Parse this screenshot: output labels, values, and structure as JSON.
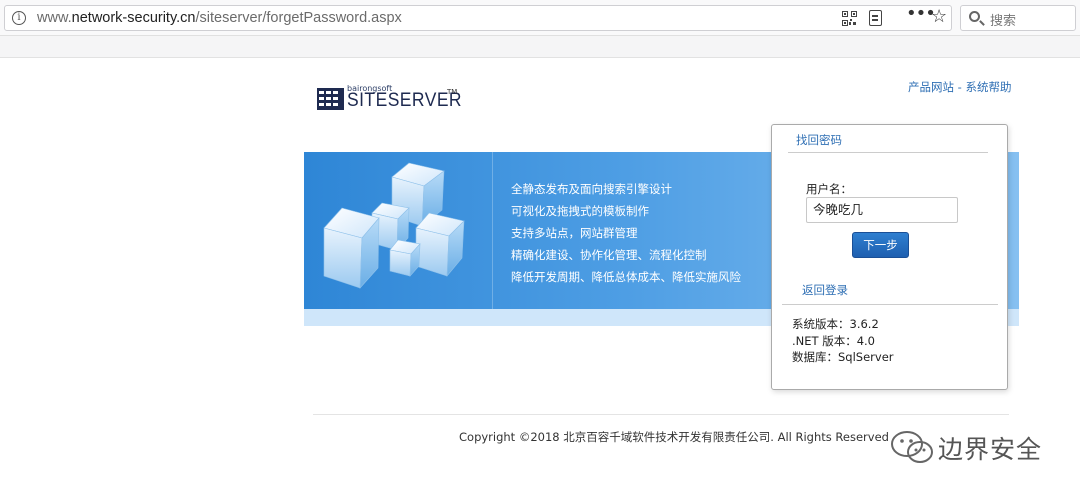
{
  "browser": {
    "url_prefix": "www.",
    "url_domain": "network-security.cn",
    "url_path": "/siteserver/forgetPassword.aspx",
    "search_placeholder": "搜索",
    "icons": [
      "info-icon",
      "qr-code-icon",
      "reader-view-icon",
      "more-dots-icon",
      "bookmark-star-icon",
      "search-icon"
    ]
  },
  "header": {
    "logo_small": "bairongsoft",
    "logo_big": "SITESERVER",
    "logo_tm": "TM",
    "link_product": "产品网站",
    "link_separator": " - ",
    "link_help": "系统帮助"
  },
  "banner": {
    "features": [
      "全静态发布及面向搜索引擎设计",
      "可视化及拖拽式的模板制作",
      "支持多站点，网站群管理",
      "精确化建设、协作化管理、流程化控制",
      "降低开发周期、降低总体成本、降低实施风险"
    ]
  },
  "panel": {
    "title": "找回密码",
    "username_label": "用户名：",
    "username_value": "今晚吃几",
    "next_button": "下一步",
    "back_link": "返回登录",
    "system_version": "系统版本：3.6.2",
    "net_version": ".NET 版本：4.0",
    "database": "数据库：SqlServer"
  },
  "footer": {
    "copyright": "Copyright ©2018 北京百容千域软件技术开发有限责任公司. All Rights Reserved"
  },
  "watermark": {
    "text": "边界安全"
  },
  "colors": {
    "link": "#2f6fb4",
    "banner_start": "#2e86d6",
    "banner_end": "#86c0f1",
    "button": "#1e5fb0"
  }
}
